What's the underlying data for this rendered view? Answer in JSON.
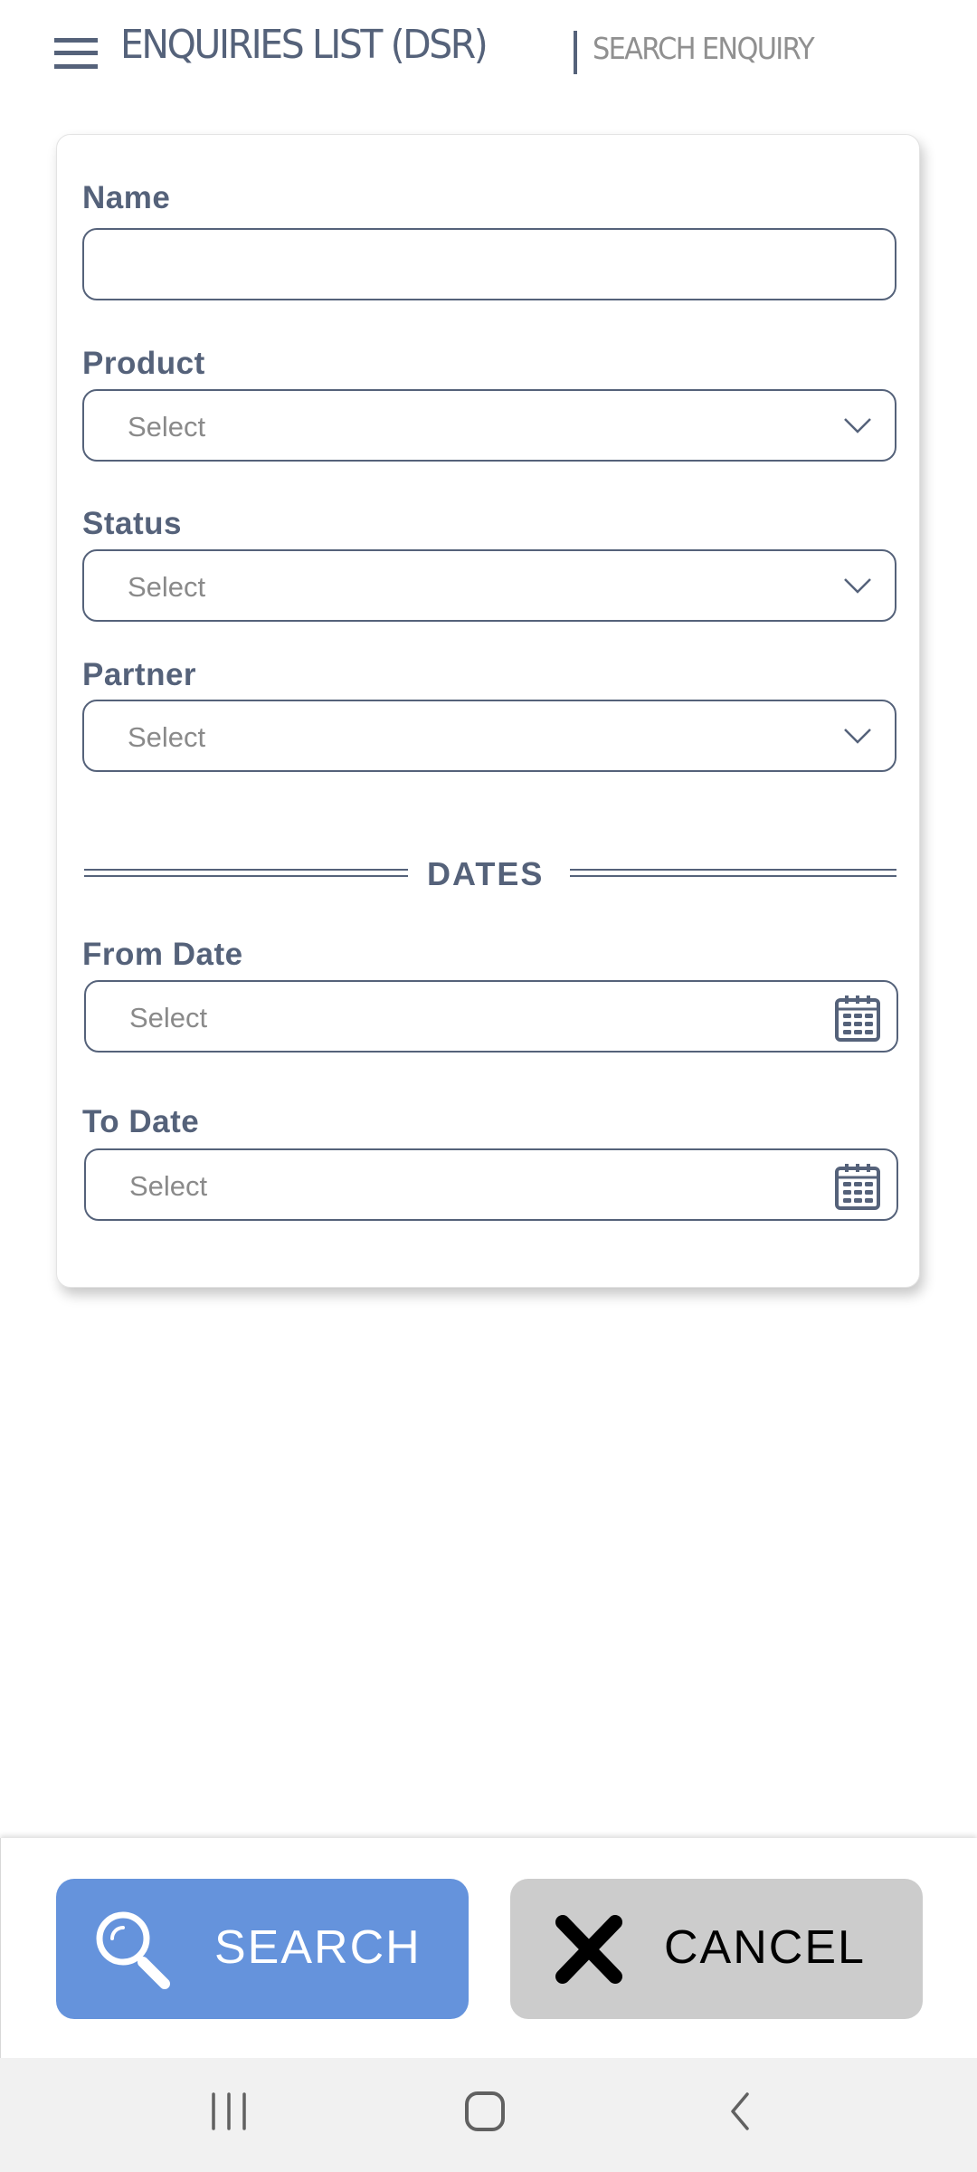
{
  "header": {
    "menu_icon": "hamburger-menu-icon",
    "title": "ENQUIRIES LIST (DSR)",
    "subtitle": "SEARCH ENQUIRY"
  },
  "form": {
    "name": {
      "label": "Name",
      "value": "",
      "placeholder": ""
    },
    "product": {
      "label": "Product",
      "placeholder": "Select",
      "icon": "chevron-down-icon"
    },
    "status": {
      "label": "Status",
      "placeholder": "Select",
      "icon": "chevron-down-icon"
    },
    "partner": {
      "label": "Partner",
      "placeholder": "Select",
      "icon": "chevron-down-icon"
    },
    "dates_section": {
      "title": "DATES"
    },
    "from_date": {
      "label": "From  Date",
      "placeholder": "Select",
      "icon": "calendar-icon"
    },
    "to_date": {
      "label": "To  Date",
      "placeholder": "Select",
      "icon": "calendar-icon"
    }
  },
  "actions": {
    "search": {
      "label": "SEARCH",
      "icon": "search-icon",
      "color": "#6593dc"
    },
    "cancel": {
      "label": "CANCEL",
      "icon": "close-icon",
      "color": "#cccccc"
    }
  },
  "system_nav": {
    "recents": "recents-icon",
    "home": "home-icon",
    "back": "back-icon"
  },
  "colors": {
    "primary_text": "#55627a",
    "subtitle_text": "#909090",
    "placeholder_text": "#8a8a8a",
    "nav_bar_bg": "#f1f1f1"
  }
}
